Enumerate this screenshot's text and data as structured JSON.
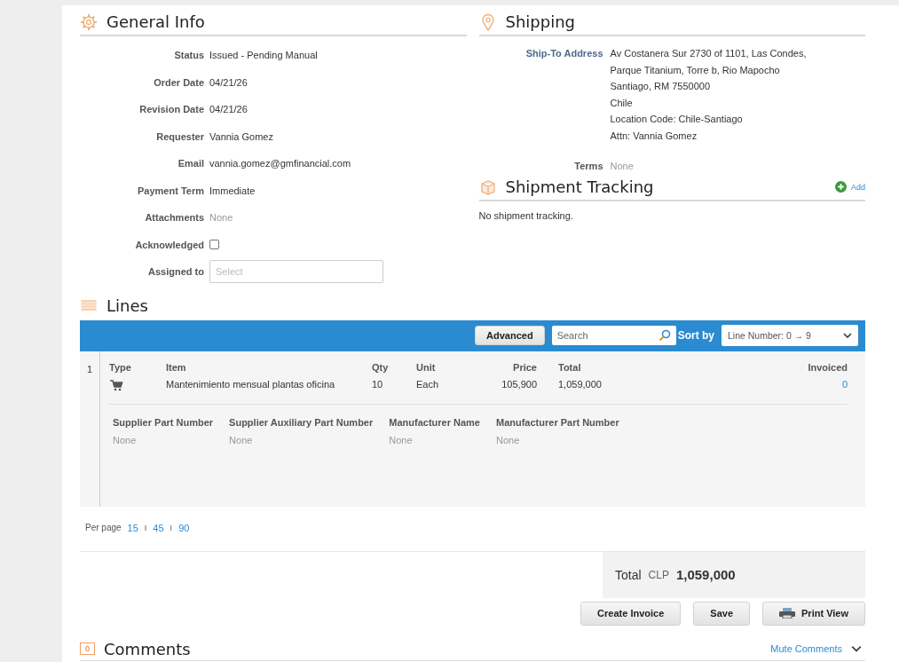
{
  "general_info": {
    "title": "General Info",
    "fields": [
      {
        "label": "Status",
        "value": "Issued - Pending Manual",
        "kind": "text"
      },
      {
        "label": "Order Date",
        "value": "04/21/26",
        "kind": "text"
      },
      {
        "label": "Revision Date",
        "value": "04/21/26",
        "kind": "text"
      },
      {
        "label": "Requester",
        "value": "Vannia Gomez",
        "kind": "text"
      },
      {
        "label": "Email",
        "value": "vannia.gomez@gmfinancial.com",
        "kind": "text"
      },
      {
        "label": "Payment Term",
        "value": "Immediate",
        "kind": "text"
      },
      {
        "label": "Attachments",
        "value": "None",
        "kind": "muted"
      },
      {
        "label": "Acknowledged",
        "checked": false,
        "kind": "checkbox"
      },
      {
        "label": "Assigned to",
        "placeholder": "Select",
        "kind": "select"
      }
    ]
  },
  "shipping": {
    "title": "Shipping",
    "address_label": "Ship-To Address",
    "address_lines": [
      "Av Costanera Sur 2730 of 1101, Las Condes,",
      "Parque Titanium, Torre b, Rio Mapocho",
      "Santiago, RM 7550000",
      "Chile",
      "Location Code: Chile-Santiago",
      "Attn: Vannia Gomez"
    ],
    "terms_label": "Terms",
    "terms_value": "None"
  },
  "shipment_tracking": {
    "title": "Shipment Tracking",
    "add_label": "Add",
    "empty_text": "No shipment tracking."
  },
  "lines": {
    "title": "Lines",
    "toolbar": {
      "advanced_label": "Advanced",
      "search_placeholder": "Search",
      "sort_label": "Sort by",
      "sort_value": "Line Number: 0 → 9"
    },
    "columns": [
      "Type",
      "Item",
      "Qty",
      "Unit",
      "Price",
      "Total",
      "Invoiced"
    ],
    "rows": [
      {
        "number": "1",
        "item": "Mantenimiento mensual plantas oficina",
        "qty": "10",
        "unit": "Each",
        "price": "105,900",
        "total": "1,059,000",
        "invoiced": "0",
        "details": [
          {
            "label": "Supplier Part Number",
            "value": "None"
          },
          {
            "label": "Supplier Auxiliary Part Number",
            "value": "None"
          },
          {
            "label": "Manufacturer Name",
            "value": "None"
          },
          {
            "label": "Manufacturer Part Number",
            "value": "None"
          }
        ]
      }
    ],
    "per_page_label": "Per page",
    "per_page_options": [
      "15",
      "45",
      "90"
    ],
    "per_page_separators": [
      "I",
      "I"
    ]
  },
  "total": {
    "label": "Total",
    "currency": "CLP",
    "amount": "1,059,000"
  },
  "buttons": [
    "Create Invoice",
    "Save",
    "Print View"
  ],
  "comments": {
    "title": "Comments",
    "count": "0",
    "mute_label": "Mute Comments"
  }
}
